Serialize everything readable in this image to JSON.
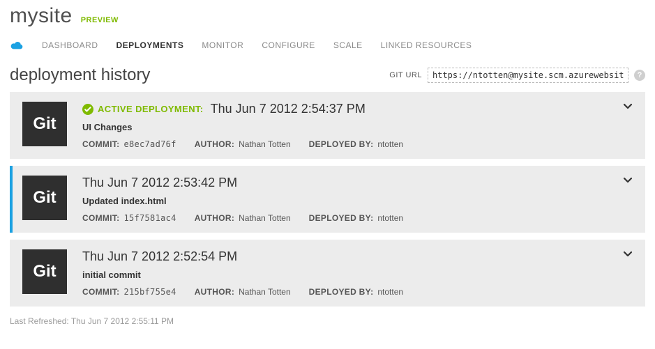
{
  "header": {
    "site_name": "mysite",
    "preview_label": "PREVIEW"
  },
  "nav": {
    "items": [
      {
        "label": "DASHBOARD"
      },
      {
        "label": "DEPLOYMENTS"
      },
      {
        "label": "MONITOR"
      },
      {
        "label": "CONFIGURE"
      },
      {
        "label": "SCALE"
      },
      {
        "label": "LINKED RESOURCES"
      }
    ],
    "active_index": 1
  },
  "section": {
    "title": "deployment history",
    "git_url_label": "GIT URL",
    "git_url_value": "https://ntotten@mysite.scm.azurewebsites.net",
    "help_glyph": "?"
  },
  "labels": {
    "commit": "COMMIT:",
    "author": "AUTHOR:",
    "deployed_by": "DEPLOYED BY:",
    "tile": "Git",
    "active_deployment": "ACTIVE DEPLOYMENT:"
  },
  "deployments": [
    {
      "active": true,
      "selected": false,
      "time": "Thu Jun 7 2012 2:54:37 PM",
      "message": "UI Changes",
      "commit": "e8ec7ad76f",
      "author": "Nathan Totten",
      "deployed_by": "ntotten"
    },
    {
      "active": false,
      "selected": true,
      "time": "Thu Jun 7 2012 2:53:42 PM",
      "message": "Updated index.html",
      "commit": "15f7581ac4",
      "author": "Nathan Totten",
      "deployed_by": "ntotten"
    },
    {
      "active": false,
      "selected": false,
      "time": "Thu Jun 7 2012 2:52:54 PM",
      "message": "initial commit",
      "commit": "215bf755e4",
      "author": "Nathan Totten",
      "deployed_by": "ntotten"
    }
  ],
  "footer": {
    "last_refreshed": "Last Refreshed: Thu Jun 7 2012 2:55:11 PM"
  },
  "colors": {
    "brand_green": "#7fba00",
    "selected_blue": "#1ba1e2",
    "card_bg": "#ececec",
    "tile_bg": "#2f2f2f"
  }
}
